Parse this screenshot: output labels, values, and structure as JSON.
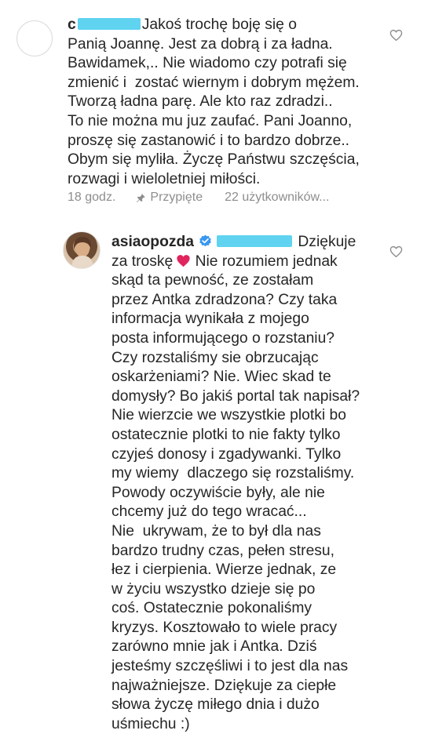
{
  "comment1": {
    "username_visible": "c",
    "text_line1": "Jakoś trochę boję się o",
    "lines": [
      "Panią Joannę. Jest za dobrą i za ładna.",
      "Bawidamek,.. Nie wiadomo czy potrafi się",
      "zmienić i  zostać wiernym i dobrym mężem.",
      "Tworzą ładna parę. Ale kto raz zdradzi..",
      "To nie można mu juz zaufać. Pani Joanno,",
      "proszę się zastanowić i to bardzo dobrze..",
      "Obym się myliła. Życzę Państwu szczęścia,",
      "rozwagi i wieloletniej miłości."
    ],
    "time": "18 godz.",
    "pinned": "Przypięte",
    "likes": "22 użytkowników..."
  },
  "comment2": {
    "username": "asiaopozda",
    "first_word": "Dziękuje",
    "line2": "za troskę",
    "line2_rest": " Nie rozumiem jednak",
    "lines": [
      "skąd ta pewność, ze zostałam",
      "przez Antka zdradzona? Czy taka",
      "informacja wynikała z mojego",
      "posta informującego o rozstaniu?",
      "Czy rozstaliśmy sie obrzucając",
      "oskarżeniami? Nie. Wiec skad te",
      "domysły? Bo jakiś portal tak napisał?",
      "Nie wierzcie we wszystkie plotki bo",
      "ostatecznie plotki to nie fakty tylko",
      "czyjeś donosy i zgadywanki. Tylko",
      "my wiemy  dlaczego się rozstaliśmy.",
      "Powody oczywiście były, ale nie",
      "chcemy już do tego wracać...",
      "Nie  ukrywam, że to był dla nas",
      "bardzo trudny czas, pełen stresu,",
      "łez i cierpienia. Wierze jednak, ze",
      "w życiu wszystko dzieje się po",
      "coś. Ostatecznie pokonaliśmy",
      "kryzys. Kosztowało to wiele pracy",
      "zarówno mnie jak i Antka. Dziś",
      "jesteśmy szczęśliwi i to jest dla nas",
      "najważniejsze. Dziękuje za ciepłe",
      "słowa życzę miłego dnia i dużo",
      "uśmiechu :)"
    ]
  },
  "colors": {
    "text": "#262626",
    "meta": "#8e8e8e",
    "redaction": "#5fd3f0",
    "heart": "#e0245e",
    "verified": "#3897f0"
  }
}
